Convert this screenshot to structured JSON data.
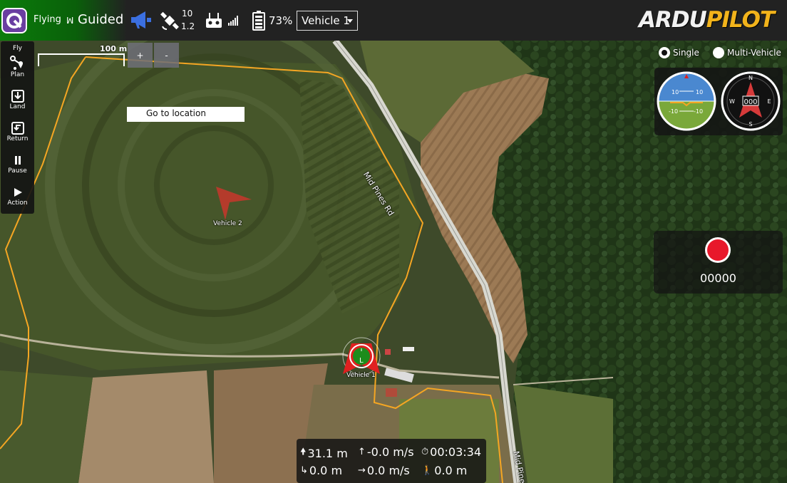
{
  "toolbar": {
    "flight_status": "Flying",
    "flight_mode": "Guided",
    "gps_satellites": "10",
    "gps_hdop": "1.2",
    "battery_percent": "73%",
    "active_vehicle": "Vehicle 1",
    "brand_part1": "ARDU",
    "brand_part2": "PILOT"
  },
  "fly_tools": {
    "header": "Fly",
    "items": [
      {
        "label": "Plan",
        "icon": "plan-icon"
      },
      {
        "label": "Land",
        "icon": "land-icon"
      },
      {
        "label": "Return",
        "icon": "return-icon"
      },
      {
        "label": "Pause",
        "icon": "pause-icon"
      },
      {
        "label": "Action",
        "icon": "action-icon"
      }
    ]
  },
  "map": {
    "scale_label": "100 m",
    "zoom_in": "+",
    "zoom_out": "-",
    "goto_tooltip": "Go to location",
    "road_name_1": "Mid Pines Rd",
    "road_name_2": "Mid Pines",
    "vehicle1_label": "Vehicle 1",
    "vehicle1_marker": "L",
    "vehicle2_label": "Vehicle 2"
  },
  "vehicle_view": {
    "single": "Single",
    "multi": "Multi-Vehicle",
    "selected": "Single"
  },
  "instruments": {
    "attitude_upper_left": "10",
    "attitude_upper_right": "10",
    "attitude_lower_left": "-10",
    "attitude_lower_right": "-10",
    "compass_heading": "000",
    "compass_n": "N",
    "compass_e": "E",
    "compass_s": "S",
    "compass_w": "W"
  },
  "video": {
    "record_time": "00000"
  },
  "telemetry": {
    "altitude": "31.1 m",
    "vertical_speed": "-0.0 m/s",
    "flight_time": "00:03:34",
    "distance": "0.0 m",
    "ground_speed": "0.0 m/s",
    "distance_to_home": "0.0 m"
  },
  "colors": {
    "flying_green": "#0b7d0b",
    "geofence": "#f5a623",
    "record_red": "#e8182b",
    "brand_gold": "#f2b31b",
    "vehicle2_red": "#c0392b"
  }
}
